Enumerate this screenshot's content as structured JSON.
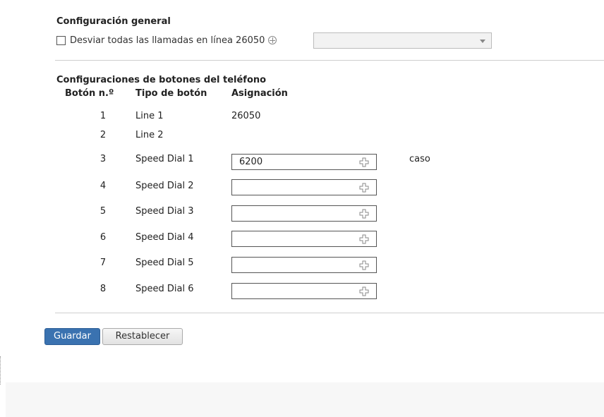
{
  "general": {
    "title": "Configuración general",
    "forward_label": "Desviar todas las llamadas en línea 26050",
    "forward_checked": false,
    "forward_select_value": ""
  },
  "buttons_section": {
    "title": "Configuraciones de botones del teléfono",
    "headers": {
      "number": "Botón n.º",
      "type": "Tipo de botón",
      "assignment": "Asignación"
    },
    "rows": [
      {
        "number": "1",
        "type": "Line 1",
        "assignment": "26050"
      },
      {
        "number": "2",
        "type": "Line 2",
        "assignment": ""
      },
      {
        "number": "3",
        "type": "Speed Dial 1",
        "input_value": "6200",
        "note": "caso"
      },
      {
        "number": "4",
        "type": "Speed Dial 2",
        "input_value": ""
      },
      {
        "number": "5",
        "type": "Speed Dial 3",
        "input_value": ""
      },
      {
        "number": "6",
        "type": "Speed Dial 4",
        "input_value": ""
      },
      {
        "number": "7",
        "type": "Speed Dial 5",
        "input_value": ""
      },
      {
        "number": "8",
        "type": "Speed Dial 6",
        "input_value": ""
      }
    ]
  },
  "actions": {
    "save": "Guardar",
    "reset": "Restablecer"
  },
  "colors": {
    "primary_button": "#3a72b0",
    "divider": "#cfcfcf"
  },
  "icons": {
    "select_arrow": "chevron-down-icon",
    "add": "plus-icon",
    "info": "circle-plus-icon"
  }
}
